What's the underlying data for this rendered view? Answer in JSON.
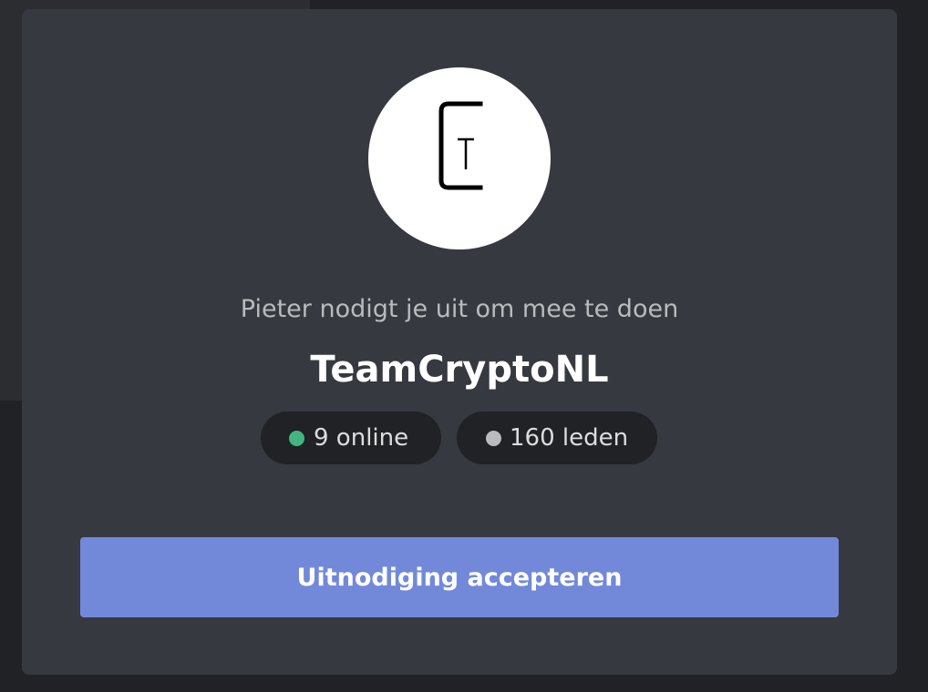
{
  "invite": {
    "avatar_icon": "teamcrypto-ct-logo-icon",
    "avatar_letters": "CT",
    "inviter_text": "Pieter nodigt je uit om mee te doen",
    "server_name": "TeamCryptoNL",
    "online_text": "9 online",
    "members_text": "160 leden",
    "accept_label": "Uitnodiging accepteren"
  },
  "colors": {
    "backdrop": "#202225",
    "card": "#36393f",
    "pill": "#202225",
    "online_dot": "#43b581",
    "members_dot": "#b9bbbe",
    "accent": "#7289da"
  }
}
